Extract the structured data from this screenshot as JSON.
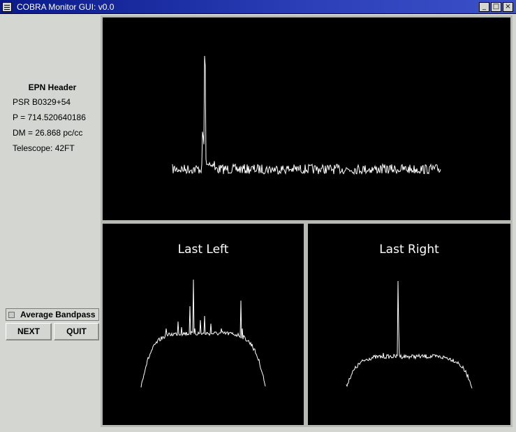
{
  "window": {
    "title": "COBRA Monitor GUI: v0.0"
  },
  "epn_header": {
    "title": "EPN Header",
    "psr": "PSR B0329+54",
    "period": "P = 714.520640186",
    "dm": "DM = 26.868 pc/cc",
    "telescope": "Telescope: 42FT"
  },
  "controls": {
    "average_bandpass_label": "Average Bandpass",
    "average_bandpass_checked": false,
    "next_label": "NEXT",
    "quit_label": "QUIT"
  },
  "plots": {
    "profile": {
      "title": ""
    },
    "last_left": {
      "title": "Last Left"
    },
    "last_right": {
      "title": "Last Right"
    }
  }
}
